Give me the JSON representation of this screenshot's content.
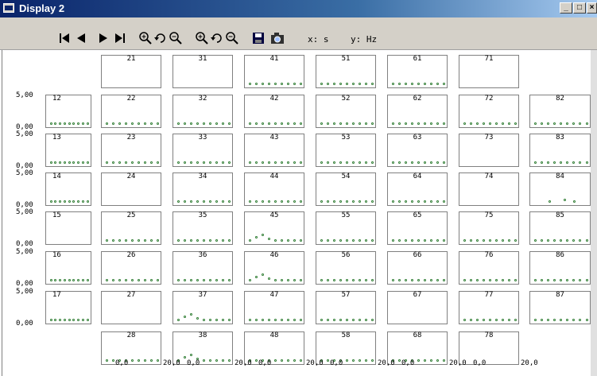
{
  "window": {
    "title": "Display 2",
    "minimize": "_",
    "maximize": "□",
    "close": "×"
  },
  "toolbar": {
    "buttons": [
      {
        "name": "first-frame-button",
        "icon": "skip-first-icon"
      },
      {
        "name": "previous-frame-button",
        "icon": "step-back-icon"
      },
      {
        "name": "next-frame-button",
        "icon": "step-forward-icon"
      },
      {
        "name": "last-frame-button",
        "icon": "skip-last-icon"
      },
      {
        "name": "zoom-in-x-button",
        "icon": "zoom-in-icon"
      },
      {
        "name": "reset-zoom-x-button",
        "icon": "reset-zoom-icon"
      },
      {
        "name": "zoom-out-x-button",
        "icon": "zoom-out-icon"
      },
      {
        "name": "zoom-in-y-button",
        "icon": "zoom-in-icon"
      },
      {
        "name": "reset-zoom-y-button",
        "icon": "reset-zoom-icon"
      },
      {
        "name": "zoom-out-y-button",
        "icon": "zoom-out-icon"
      },
      {
        "name": "save-button",
        "icon": "floppy-disk-icon"
      },
      {
        "name": "snapshot-button",
        "icon": "camera-icon"
      }
    ],
    "x_readout": "x: s",
    "y_readout": "y: Hz"
  },
  "axes": {
    "y_max_label": "5,00",
    "y_min_label": "0,00",
    "x_min_label": "0,0",
    "x_max_label": "20,0"
  },
  "colors": {
    "dot": "#2e7d32",
    "title_bar": "#0a246a",
    "toolbar": "#d4d0c8"
  },
  "cells": [
    {
      "label": "21",
      "dots": ""
    },
    {
      "label": "31",
      "dots": ""
    },
    {
      "label": "41",
      "dots": "flat"
    },
    {
      "label": "51",
      "dots": "flat"
    },
    {
      "label": "61",
      "dots": "flat"
    },
    {
      "label": "71",
      "dots": ""
    },
    {
      "label": "12",
      "dots": "flat"
    },
    {
      "label": "22",
      "dots": "flat"
    },
    {
      "label": "32",
      "dots": "flat"
    },
    {
      "label": "42",
      "dots": "flat"
    },
    {
      "label": "52",
      "dots": "flat"
    },
    {
      "label": "62",
      "dots": "flat"
    },
    {
      "label": "72",
      "dots": "flat"
    },
    {
      "label": "82",
      "dots": "flat"
    },
    {
      "label": "13",
      "dots": "flat"
    },
    {
      "label": "23",
      "dots": "flat"
    },
    {
      "label": "33",
      "dots": "flat"
    },
    {
      "label": "43",
      "dots": "flat"
    },
    {
      "label": "53",
      "dots": "flat"
    },
    {
      "label": "63",
      "dots": "flat"
    },
    {
      "label": "73",
      "dots": ""
    },
    {
      "label": "83",
      "dots": "flat"
    },
    {
      "label": "14",
      "dots": "flat"
    },
    {
      "label": "24",
      "dots": ""
    },
    {
      "label": "34",
      "dots": "flat"
    },
    {
      "label": "44",
      "dots": "flat"
    },
    {
      "label": "54",
      "dots": "flat"
    },
    {
      "label": "64",
      "dots": "flat"
    },
    {
      "label": "74",
      "dots": ""
    },
    {
      "label": "84",
      "dots": "sparse"
    },
    {
      "label": "15",
      "dots": ""
    },
    {
      "label": "25",
      "dots": "flat"
    },
    {
      "label": "35",
      "dots": "flat"
    },
    {
      "label": "45",
      "dots": "bump"
    },
    {
      "label": "55",
      "dots": "flat"
    },
    {
      "label": "65",
      "dots": "flat"
    },
    {
      "label": "75",
      "dots": "flat"
    },
    {
      "label": "85",
      "dots": "flat"
    },
    {
      "label": "16",
      "dots": "flat"
    },
    {
      "label": "26",
      "dots": "flat"
    },
    {
      "label": "36",
      "dots": "flat"
    },
    {
      "label": "46",
      "dots": "bump"
    },
    {
      "label": "56",
      "dots": "flat"
    },
    {
      "label": "66",
      "dots": "flat"
    },
    {
      "label": "76",
      "dots": "flat"
    },
    {
      "label": "86",
      "dots": "flat"
    },
    {
      "label": "17",
      "dots": "flat"
    },
    {
      "label": "27",
      "dots": ""
    },
    {
      "label": "37",
      "dots": "bump"
    },
    {
      "label": "47",
      "dots": "flat"
    },
    {
      "label": "57",
      "dots": "flat"
    },
    {
      "label": "67",
      "dots": ""
    },
    {
      "label": "77",
      "dots": "flat"
    },
    {
      "label": "87",
      "dots": "flat"
    },
    {
      "label": "28",
      "dots": "flat"
    },
    {
      "label": "38",
      "dots": "bump"
    },
    {
      "label": "48",
      "dots": "flat"
    },
    {
      "label": "58",
      "dots": "flat"
    },
    {
      "label": "68",
      "dots": "flat"
    },
    {
      "label": "78",
      "dots": ""
    }
  ]
}
